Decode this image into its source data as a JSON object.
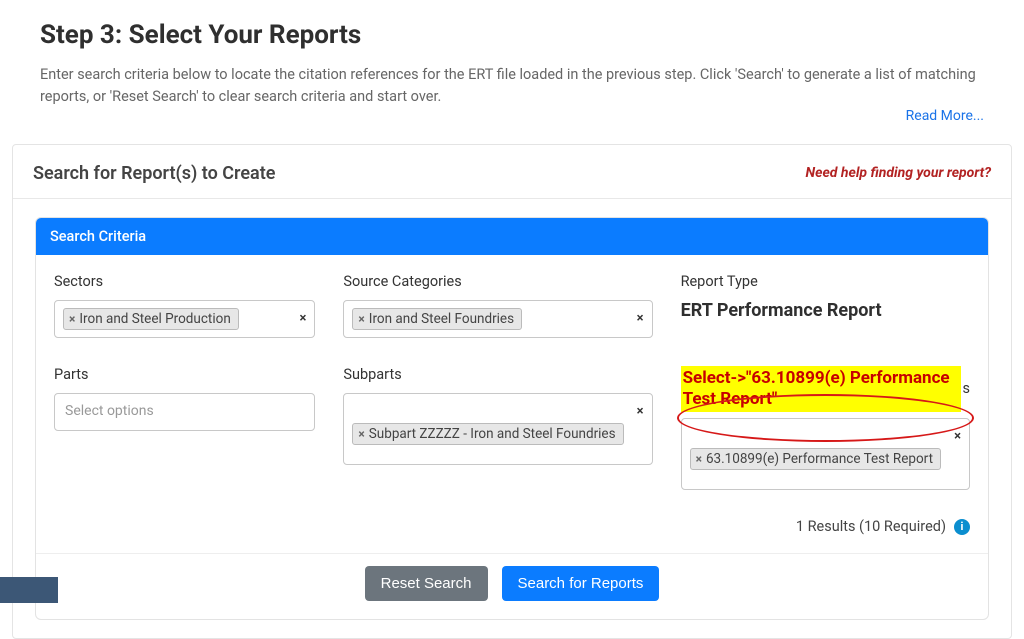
{
  "header": {
    "title": "Step 3: Select Your Reports",
    "instructions": "Enter search criteria below to locate the citation references for the ERT file loaded in the previous step. Click 'Search' to generate a list of matching reports, or 'Reset Search' to clear search criteria and start over.",
    "read_more": "Read More..."
  },
  "panel": {
    "title": "Search for Report(s) to Create",
    "help_link": "Need help finding your report?"
  },
  "criteria": {
    "header": "Search Criteria",
    "sectors": {
      "label": "Sectors",
      "tags": [
        "Iron and Steel Production"
      ]
    },
    "source_categories": {
      "label": "Source Categories",
      "tags": [
        "Iron and Steel Foundries"
      ]
    },
    "report_type": {
      "label": "Report Type",
      "value": "ERT Performance Report"
    },
    "parts": {
      "label": "Parts",
      "placeholder": "Select options"
    },
    "subparts": {
      "label": "Subparts",
      "tags": [
        "Subpart ZZZZZ - Iron and Steel Foundries"
      ]
    },
    "citations": {
      "annotation": "Select->\"63.10899(e) Performance Test Report\"",
      "label_suffix": "s",
      "tags": [
        "63.10899(e) Performance Test Report"
      ]
    },
    "results": "1 Results (10 Required)"
  },
  "buttons": {
    "reset": "Reset Search",
    "search": "Search for Reports"
  }
}
